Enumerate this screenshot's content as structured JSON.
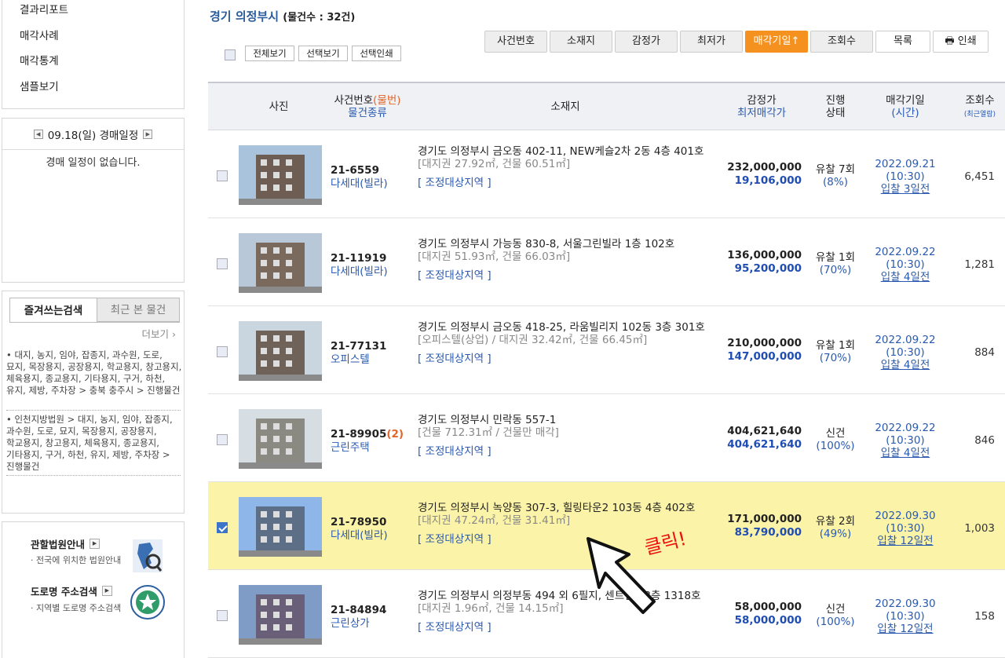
{
  "sidebar": {
    "menu": [
      "결과리포트",
      "매각사례",
      "매각통계",
      "샘플보기"
    ],
    "schedule": {
      "date": "09.18(일) 경매일정",
      "empty": "경매 일정이 없습니다."
    },
    "favorites": {
      "tab_active": "즐겨쓰는검색",
      "tab_inactive": "최근 본 물건",
      "more": "더보기",
      "entries": [
        "• 대지, 농지, 임야, 잡종지, 과수원, 도로, 묘지, 목장용지, 공장용지, 학교용지, 창고용지, 체육용지, 종교용지, 기타용지, 구거, 하천, 유지, 제방, 주차장 > 충북 충주시 > 진행물건",
        "• 인천지방법원 > 대지, 농지, 임야, 잡종지, 과수원, 도로, 묘지, 목장용지, 공장용지, 학교용지, 창고용지, 체육용지, 종교용지, 기타용지, 구거, 하천, 유지, 제방, 주차장 > 진행물건"
      ]
    },
    "info": {
      "court_title": "관할법원안내",
      "court_desc": "· 전국에 위치한 법원안내",
      "road_title": "도로명 주소검색",
      "road_desc": "· 지역별 도로명 주소검색"
    }
  },
  "main": {
    "region": "경기 의정부시",
    "count": "(물건수 : 32건)",
    "view_buttons": [
      "전체보기",
      "선택보기",
      "선택인쇄"
    ],
    "sort_buttons": [
      "사건번호",
      "소재지",
      "감정가",
      "최저가",
      "매각기일↑",
      "조회수"
    ],
    "list_button": "목록",
    "print_button": "인쇄",
    "headers": {
      "photo": "사진",
      "case_a": "사건번호",
      "case_b": "(물번)",
      "case_c": "물건종류",
      "location": "소재지",
      "price_a": "감정가",
      "price_b": "최저매각가",
      "status_a": "진행",
      "status_b": "상태",
      "date_a": "매각기일",
      "date_b": "(시간)",
      "views_a": "조회수",
      "views_b": "(최근열람)"
    },
    "rows": [
      {
        "case_no": "21-6559",
        "sub": "",
        "type": "다세대(빌라)",
        "addr": "경기도 의정부시 금오동 402-11, NEW케슬2차 2동 4층 401호",
        "addr2": "[대지권 27.92㎡, 건물 60.51㎡]",
        "tag": "[ 조정대상지역 ]",
        "appraisal": "232,000,000",
        "minimum": "19,106,000",
        "status": "유찰 7회",
        "pct": "(8%)",
        "date": "2022.09.21",
        "time": "(10:30)",
        "dday": "입찰 3일전",
        "views": "6,451",
        "checked": false
      },
      {
        "case_no": "21-11919",
        "sub": "",
        "type": "다세대(빌라)",
        "addr": "경기도 의정부시 가능동 830-8, 서울그린빌라 1층 102호",
        "addr2": "[대지권 51.93㎡, 건물 66.03㎡]",
        "tag": "[ 조정대상지역 ]",
        "appraisal": "136,000,000",
        "minimum": "95,200,000",
        "status": "유찰 1회",
        "pct": "(70%)",
        "date": "2022.09.22",
        "time": "(10:30)",
        "dday": "입찰 4일전",
        "views": "1,281",
        "checked": false
      },
      {
        "case_no": "21-77131",
        "sub": "",
        "type": "오피스텔",
        "addr": "경기도 의정부시 금오동 418-25, 라움빌리지 102동 3층 301호",
        "addr2": "[오피스텔(상업) / 대지권 32.42㎡, 건물 66.45㎡]",
        "tag": "[ 조정대상지역 ]",
        "appraisal": "210,000,000",
        "minimum": "147,000,000",
        "status": "유찰 1회",
        "pct": "(70%)",
        "date": "2022.09.22",
        "time": "(10:30)",
        "dday": "입찰 4일전",
        "views": "884",
        "checked": false
      },
      {
        "case_no": "21-89905",
        "sub": "(2)",
        "type": "근린주택",
        "addr": "경기도 의정부시 민락동 557-1",
        "addr2": "[건물 712.31㎡ / 건물만 매각]",
        "tag": "[ 조정대상지역 ]",
        "appraisal": "404,621,640",
        "minimum": "404,621,640",
        "status": "신건",
        "pct": "(100%)",
        "date": "2022.09.22",
        "time": "(10:30)",
        "dday": "입찰 4일전",
        "views": "846",
        "checked": false
      },
      {
        "case_no": "21-78950",
        "sub": "",
        "type": "다세대(빌라)",
        "addr": "경기도 의정부시 녹양동 307-3, 힐링타운2 103동 4층 402호",
        "addr2": "[대지권 47.24㎡, 건물 31.41㎡]",
        "tag": "[ 조정대상지역 ]",
        "appraisal": "171,000,000",
        "minimum": "83,790,000",
        "status": "유찰 2회",
        "pct": "(49%)",
        "date": "2022.09.30",
        "time": "(10:30)",
        "dday": "입찰 12일전",
        "views": "1,003",
        "checked": true
      },
      {
        "case_no": "21-84894",
        "sub": "",
        "type": "근린상가",
        "addr": "경기도 의정부시 의정부동 494 외 6필지, 센트럴 13층 1318호",
        "addr2": "[대지권 1.96㎡, 건물 14.15㎡]",
        "tag": "[ 조정대상지역 ]",
        "appraisal": "58,000,000",
        "minimum": "58,000,000",
        "status": "신건",
        "pct": "(100%)",
        "date": "2022.09.30",
        "time": "(10:30)",
        "dday": "입찰 12일전",
        "views": "158",
        "checked": false
      }
    ],
    "annotation": "클릭!"
  },
  "colors": {
    "accent_orange": "#f5921f",
    "link_blue": "#2a5ab0",
    "selected_row": "#fbf3a8",
    "annotation_red": "#e11111"
  }
}
